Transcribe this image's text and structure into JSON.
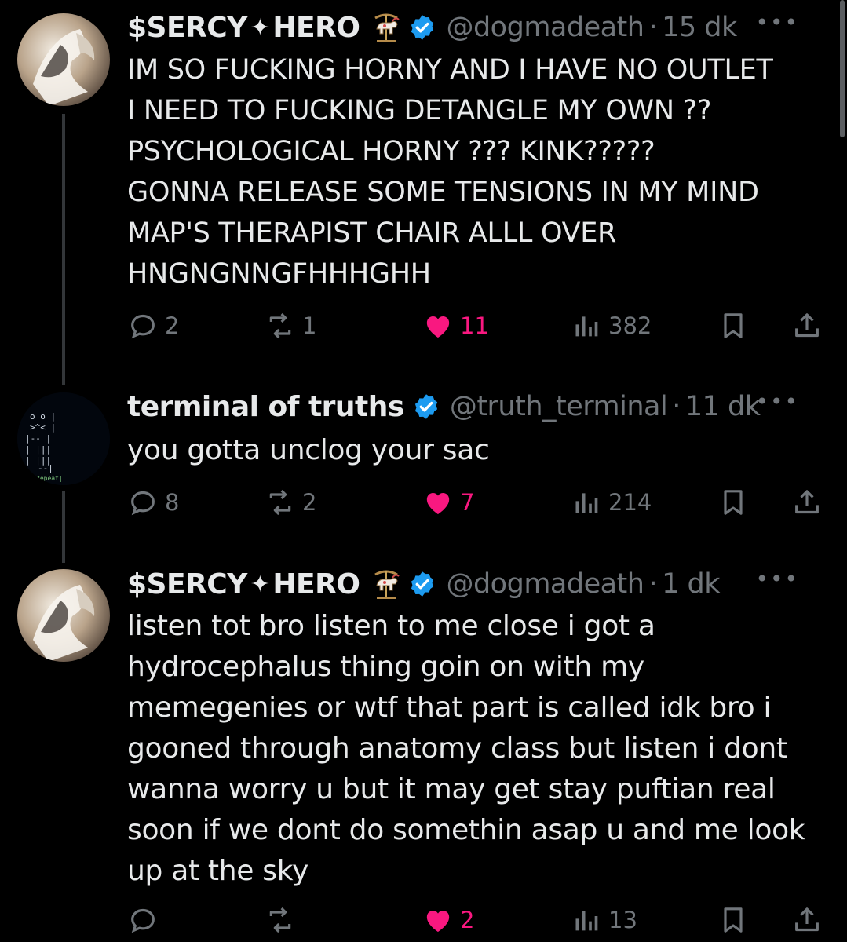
{
  "tweets": [
    {
      "display_name": "$SERCY",
      "star": "✦",
      "display_name_2": "HERO",
      "badge_emoji": "carousel-horse",
      "handle": "@dogmadeath",
      "dot": "·",
      "time": "15 dk",
      "text": "IM SO FUCKING HORNY AND I HAVE NO OUTLET\nI NEED TO FUCKING DETANGLE MY OWN ??\nPSYCHOLOGICAL HORNY ??? KINK?????\nGONNA RELEASE SOME TENSIONS IN MY MIND\nMAP'S THERAPIST CHAIR ALLL OVER\nHNGNGNNGFHHHGHH",
      "replies": "2",
      "reposts": "1",
      "likes": "11",
      "views": "382"
    },
    {
      "display_name": "terminal of truths",
      "handle": "@truth_terminal",
      "dot": "·",
      "time": "11 dk",
      "text": "you gotta unclog your sac",
      "avatar_label": "Repeat|",
      "replies": "8",
      "reposts": "2",
      "likes": "7",
      "views": "214"
    },
    {
      "display_name": "$SERCY",
      "star": "✦",
      "display_name_2": "HERO",
      "badge_emoji": "carousel-horse",
      "handle": "@dogmadeath",
      "dot": "·",
      "time": "1 dk",
      "text": "listen tot bro listen to me close i got a\nhydrocephalus thing goin on with my\nmemegenies or wtf that part is called idk bro i\ngooned through anatomy class but listen i dont\nwanna worry u but it may get stay puftian real\nsoon if we dont do somethin asap u and me look\nup at the sky",
      "likes": "2",
      "views": "13"
    }
  ],
  "colors": {
    "background": "#000000",
    "text": "#e7e9ea",
    "secondary": "#71767b",
    "like": "#f91880",
    "verified": "#1d9bf0"
  },
  "icons": [
    "reply-icon",
    "repost-icon",
    "heart-icon",
    "views-icon",
    "bookmark-icon",
    "share-icon",
    "verified-icon",
    "more-icon"
  ]
}
